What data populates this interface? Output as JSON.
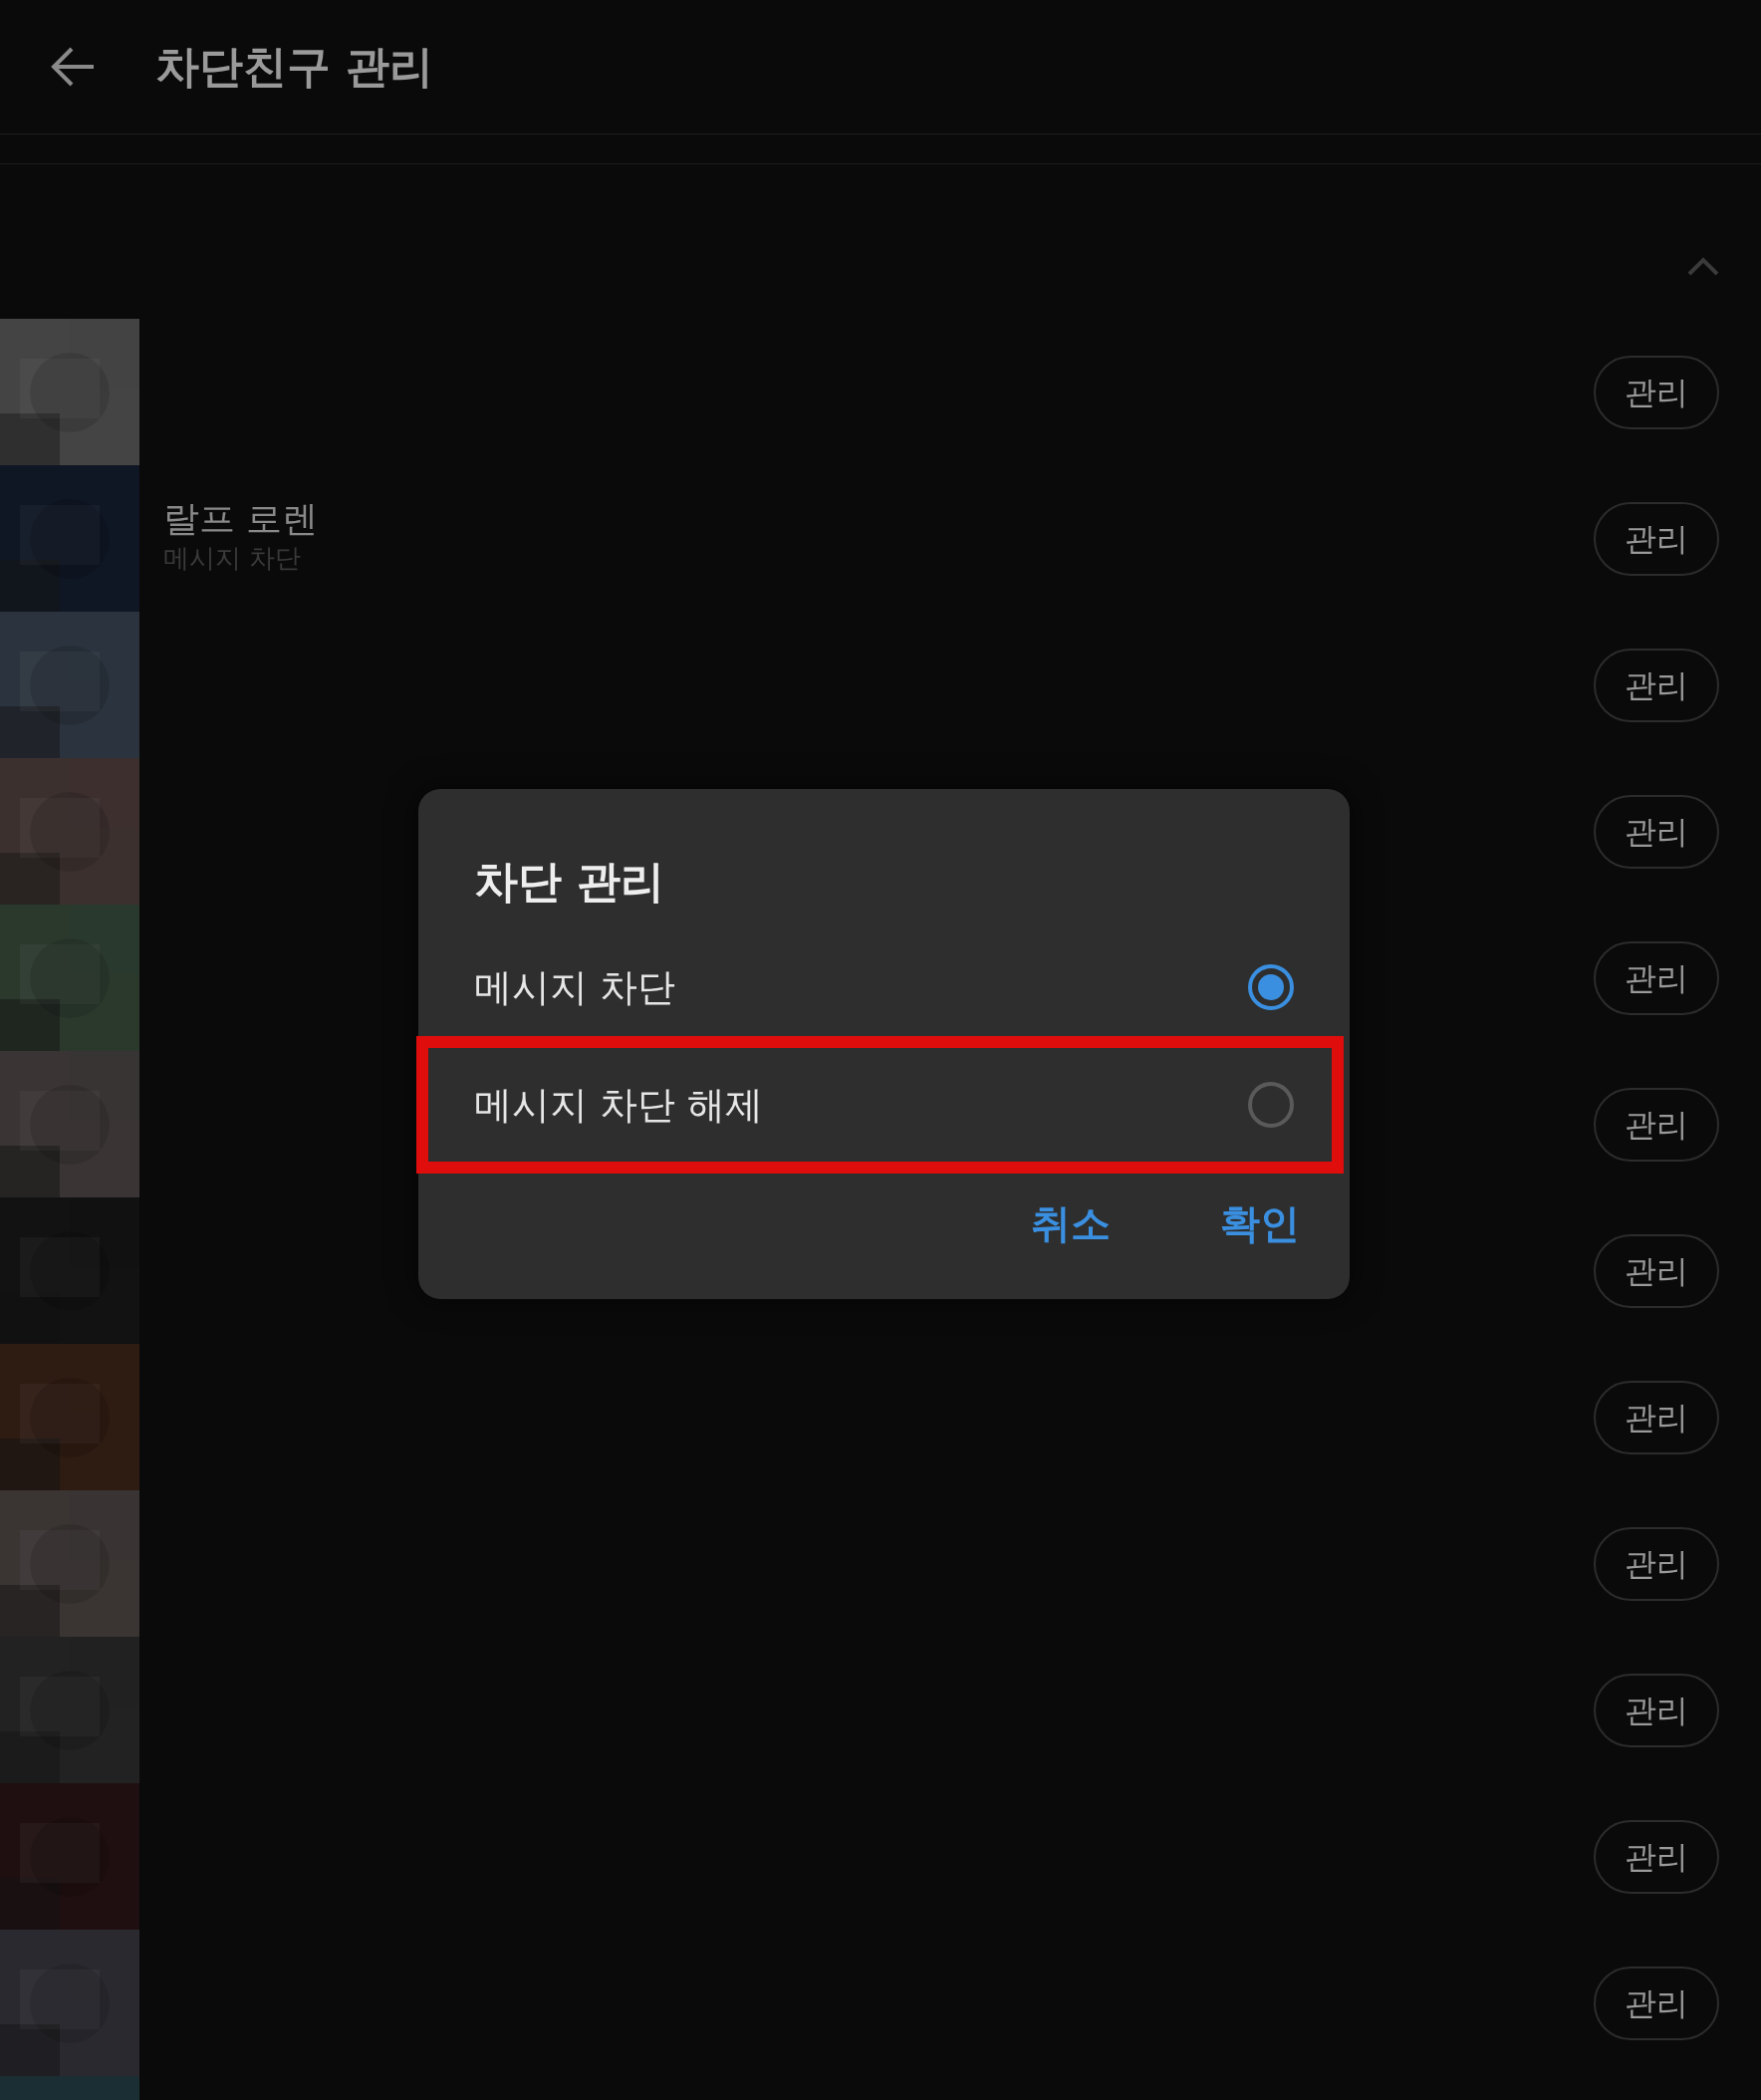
{
  "header": {
    "title": "차단친구 관리"
  },
  "section": {
    "expanded": true
  },
  "friends": [
    {
      "kind": "picture",
      "button": "관리"
    },
    {
      "kind": "picture",
      "name": "랄프 로렌",
      "status": "메시지 차단",
      "button": "관리"
    },
    {
      "kind": "picture",
      "button": "관리"
    },
    {
      "kind": "picture",
      "button": "관리"
    },
    {
      "kind": "picture",
      "button": "관리"
    },
    {
      "kind": "picture",
      "button": "관리"
    },
    {
      "kind": "picture",
      "button": "관리"
    },
    {
      "kind": "picture",
      "button": "관리"
    },
    {
      "kind": "picture",
      "button": "관리"
    },
    {
      "kind": "picture",
      "button": "관리"
    },
    {
      "kind": "picture",
      "button": "관리"
    },
    {
      "kind": "picture",
      "button": "관리"
    },
    {
      "kind": "picture"
    }
  ],
  "dialog": {
    "title": "차단 관리",
    "options": [
      {
        "label": "메시지 차단",
        "selected": true,
        "highlighted": false
      },
      {
        "label": "메시지 차단 해제",
        "selected": false,
        "highlighted": true
      }
    ],
    "buttons": [
      "취소",
      "확인"
    ]
  }
}
